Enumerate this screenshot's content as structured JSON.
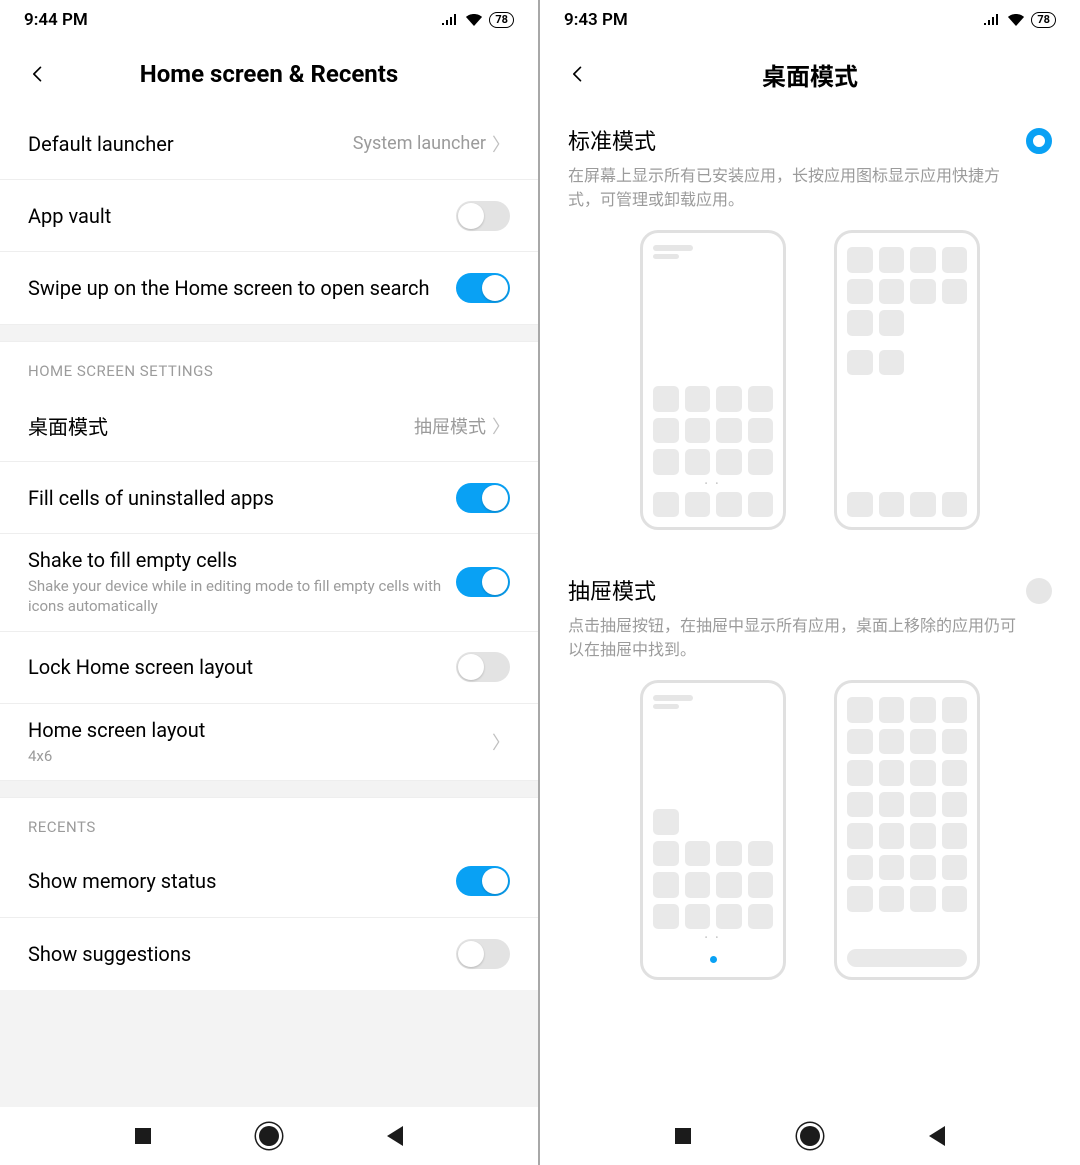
{
  "left": {
    "status_time": "9:44 PM",
    "battery": "78",
    "header_title": "Home screen & Recents",
    "rows": {
      "default_launcher": {
        "label": "Default launcher",
        "value": "System launcher"
      },
      "app_vault": {
        "label": "App vault"
      },
      "swipe_search": {
        "label": "Swipe up on the Home screen to open search"
      }
    },
    "section_home": "HOME SCREEN SETTINGS",
    "rows2": {
      "desktop_mode": {
        "label": "桌面模式",
        "value": "抽屉模式"
      },
      "fill_cells": {
        "label": "Fill cells of uninstalled apps"
      },
      "shake_fill": {
        "label": "Shake to fill empty cells",
        "sub": "Shake your device while in editing mode to fill empty cells with icons automatically"
      },
      "lock_layout": {
        "label": "Lock Home screen layout"
      },
      "layout": {
        "label": "Home screen layout",
        "sub": "4x6"
      }
    },
    "section_recents": "RECENTS",
    "rows3": {
      "memory": {
        "label": "Show memory status"
      },
      "suggestions": {
        "label": "Show suggestions"
      }
    }
  },
  "right": {
    "status_time": "9:43 PM",
    "battery": "78",
    "header_title": "桌面模式",
    "mode1": {
      "title": "标准模式",
      "desc": "在屏幕上显示所有已安装应用，长按应用图标显示应用快捷方式，可管理或卸载应用。"
    },
    "mode2": {
      "title": "抽屉模式",
      "desc": "点击抽屉按钮，在抽屉中显示所有应用，桌面上移除的应用仍可以在抽屉中找到。"
    }
  }
}
